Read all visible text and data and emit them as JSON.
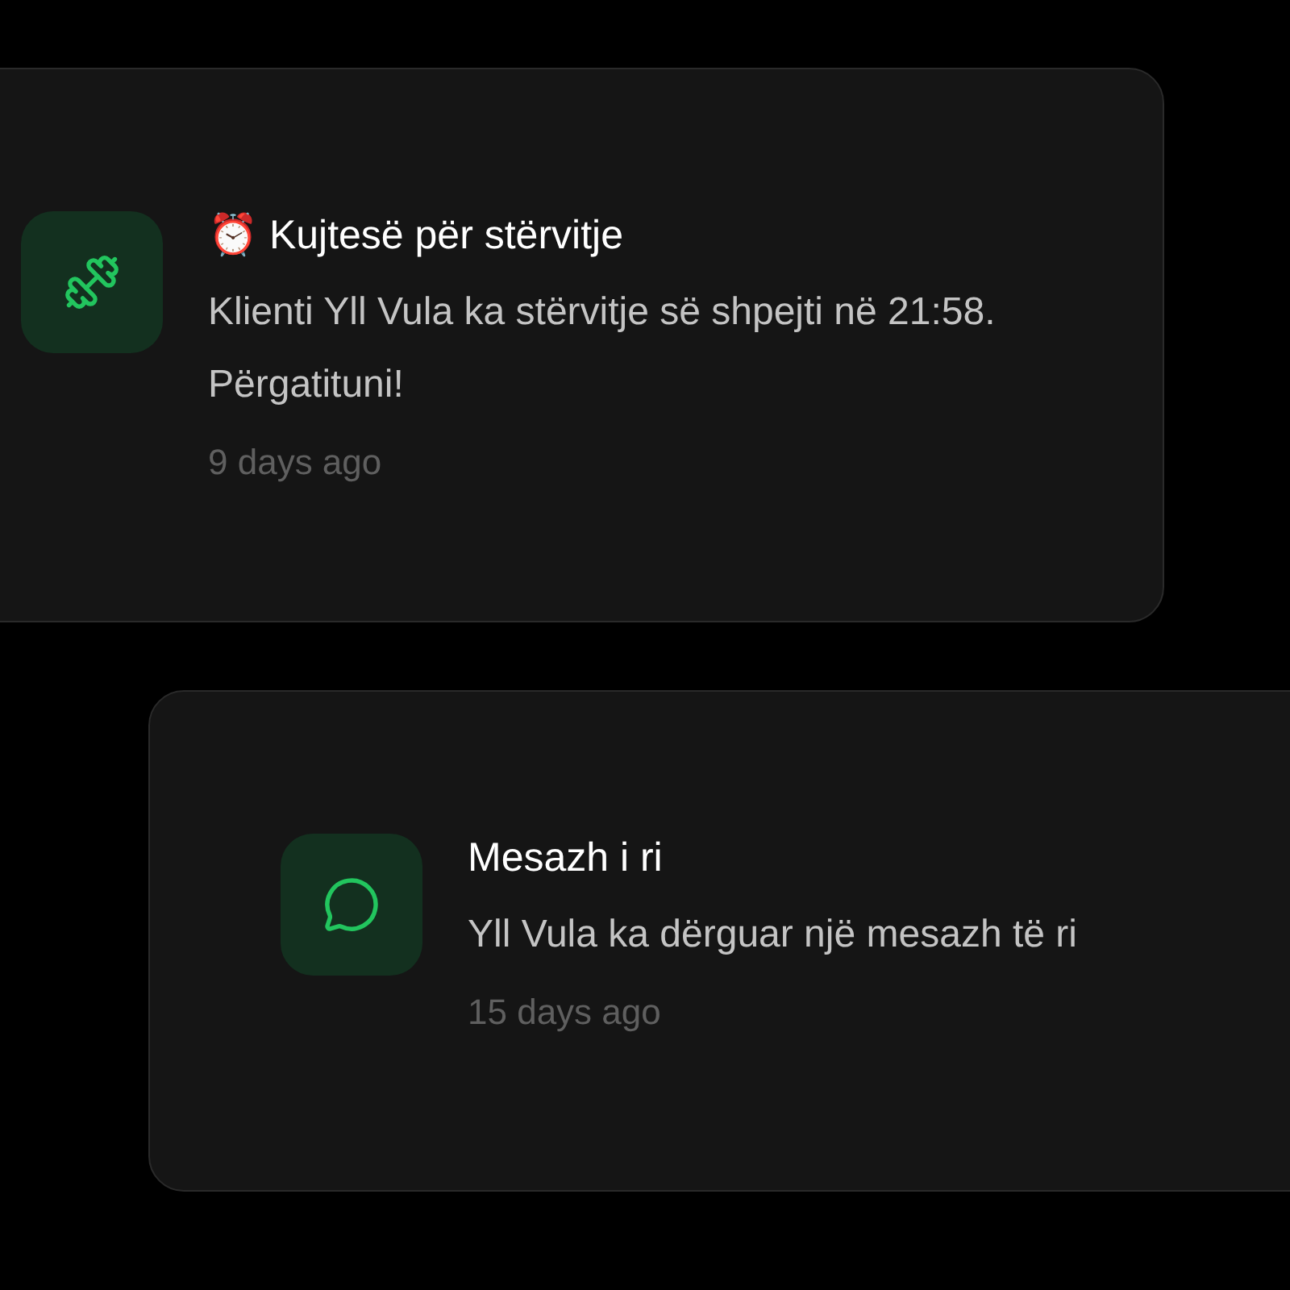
{
  "notifications": [
    {
      "kind": "workout",
      "title": "⏰ Kujtesë për stërvitje",
      "body": "Klienti Yll Vula ka stërvitje së shpejti në 21:58. Përgatituni!",
      "time": "9 days ago"
    },
    {
      "kind": "message",
      "title": "Mesazh i ri",
      "body": "Yll Vula ka dërguar një mesazh të ri",
      "time": "15 days ago"
    }
  ]
}
